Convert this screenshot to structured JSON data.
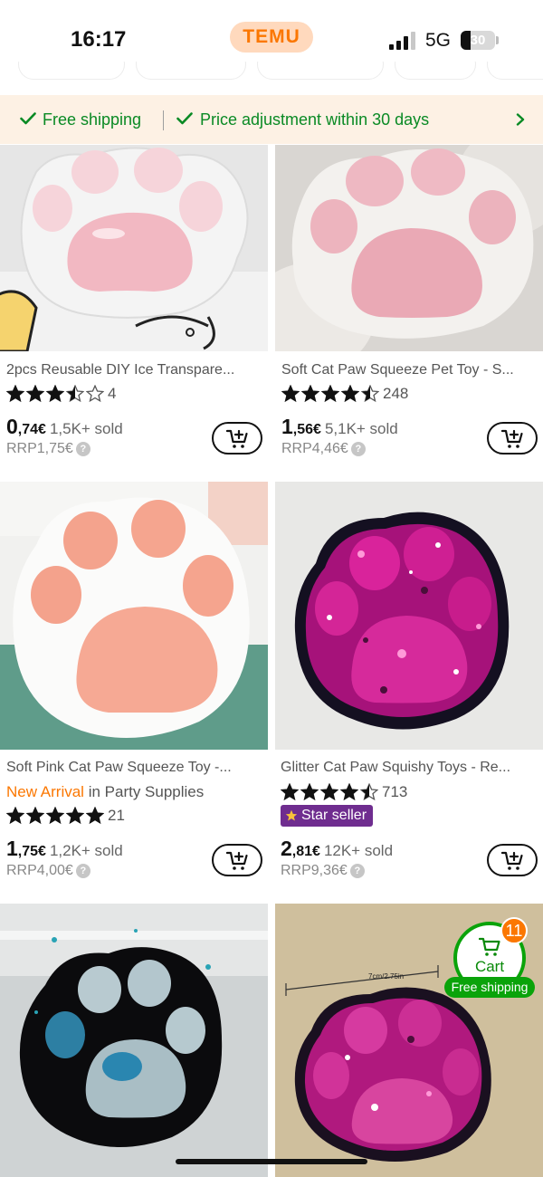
{
  "status_bar": {
    "time": "16:17",
    "brand": "TEMU",
    "network": "5G",
    "battery": "30",
    "battery_level": 0.3
  },
  "banner": {
    "free_shipping": "Free shipping",
    "price_adjustment": "Price adjustment within 30 days",
    "accent_color": "#0a8a24"
  },
  "products": [
    {
      "title": "2pcs Reusable DIY Ice Transpare...",
      "rating": 3.5,
      "reviews": "4",
      "price_int": "0",
      "price_dec": ",74€",
      "sold": "1,5K+ sold",
      "rrp": "RRP1,75€"
    },
    {
      "title": "Soft Cat Paw Squeeze Pet Toy - S...",
      "rating": 4.5,
      "reviews": "248",
      "price_int": "1",
      "price_dec": ",56€",
      "sold": "5,1K+ sold",
      "rrp": "RRP4,46€"
    },
    {
      "title": "Soft Pink Cat Paw Squeeze Toy -...",
      "tag_accent": "New Arrival",
      "tag_rest": " in Party Supplies",
      "rating": 5,
      "reviews": "21",
      "price_int": "1",
      "price_dec": ",75€",
      "sold": "1,2K+ sold",
      "rrp": "RRP4,00€"
    },
    {
      "title": "Glitter Cat Paw Squishy Toys - Re...",
      "rating": 4.5,
      "reviews": "713",
      "badge": "Star seller",
      "price_int": "2",
      "price_dec": ",81€",
      "sold": "12K+ sold",
      "rrp": "RRP9,36€"
    }
  ],
  "image_annotation": "7cm/2.75in",
  "floating_cart": {
    "label": "Cart",
    "count": "11",
    "free_shipping": "Free shipping",
    "color": "#0aa30a"
  },
  "colors": {
    "brand": "#fb7701",
    "star_seller_bg": "#6f2d8f"
  }
}
